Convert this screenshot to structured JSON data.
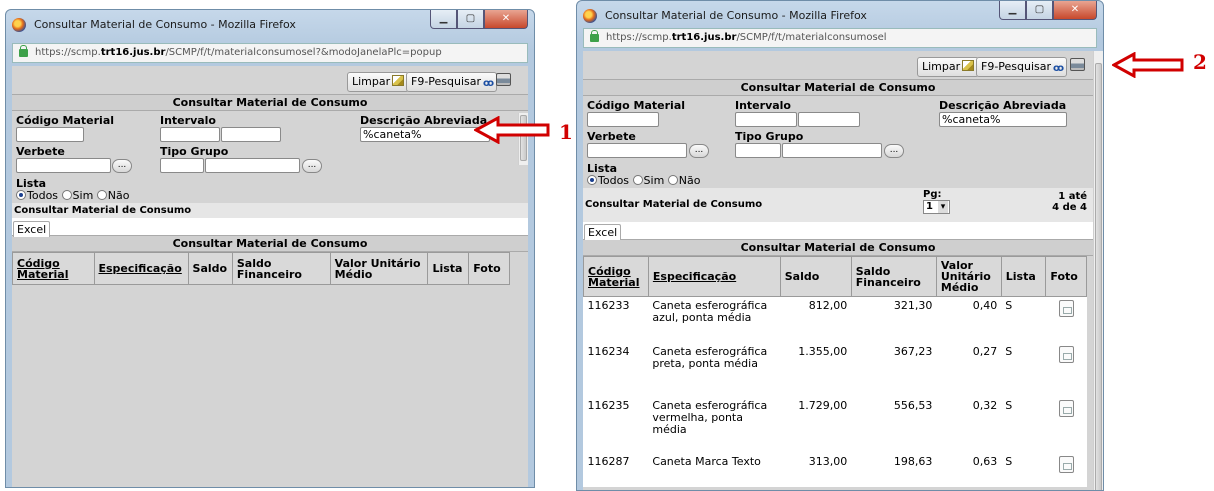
{
  "left_window": {
    "title": "Consultar Material de Consumo - Mozilla Firefox",
    "url_prefix": "https://scmp.",
    "url_domain": "trt16.jus.br",
    "url_path": "/SCMP/f/t/materialconsumosel?&modoJanelaPlc=popup",
    "toolbar": {
      "limpar": "Limpar",
      "pesquisar": "F9-Pesquisar"
    },
    "section_title": "Consultar Material de Consumo",
    "form": {
      "codigo_label": "Código Material",
      "intervalo_label": "Intervalo",
      "descricao_label": "Descrição Abreviada",
      "descricao_value": "%caneta%",
      "verbete_label": "Verbete",
      "tipo_grupo_label": "Tipo Grupo",
      "lista_label": "Lista",
      "dots_label": "...",
      "radio_todos": "Todos",
      "radio_sim": "Sim",
      "radio_nao": "Não"
    },
    "results_header": "Consultar Material de Consumo",
    "excel": "Excel",
    "grid_title": "Consultar Material de Consumo",
    "columns": [
      "Código Material",
      "Especificação",
      "Saldo",
      "Saldo Financeiro",
      "Valor Unitário Médio",
      "Lista",
      "Foto"
    ]
  },
  "right_window": {
    "title": "Consultar Material de Consumo - Mozilla Firefox",
    "url_prefix": "https://scmp.",
    "url_domain": "trt16.jus.br",
    "url_path": "/SCMP/f/t/materialconsumosel",
    "toolbar": {
      "limpar": "Limpar",
      "pesquisar": "F9-Pesquisar"
    },
    "section_title": "Consultar Material de Consumo",
    "form": {
      "codigo_label": "Código Material",
      "intervalo_label": "Intervalo",
      "descricao_label": "Descrição Abreviada",
      "descricao_value": "%caneta%",
      "verbete_label": "Verbete",
      "tipo_grupo_label": "Tipo Grupo",
      "lista_label": "Lista",
      "dots_label": "...",
      "radio_todos": "Todos",
      "radio_sim": "Sim",
      "radio_nao": "Não"
    },
    "results_header": "Consultar Material de Consumo",
    "pg_label": "Pg:",
    "pg_value": "1",
    "range_line1": "1 até",
    "range_line2": "4 de 4",
    "excel": "Excel",
    "grid_title": "Consultar Material de Consumo",
    "columns": [
      "Código Material",
      "Especificação",
      "Saldo",
      "Saldo Financeiro",
      "Valor Unitário Médio",
      "Lista",
      "Foto"
    ],
    "rows": [
      {
        "codigo": "116233",
        "especificacao": "Caneta esferográfica azul, ponta média",
        "saldo": "812,00",
        "saldo_fin": "321,30",
        "valor": "0,40",
        "lista": "S"
      },
      {
        "codigo": "116234",
        "especificacao": "Caneta esferográfica preta, ponta média",
        "saldo": "1.355,00",
        "saldo_fin": "367,23",
        "valor": "0,27",
        "lista": "S"
      },
      {
        "codigo": "116235",
        "especificacao": "Caneta esferográfica vermelha, ponta média",
        "saldo": "1.729,00",
        "saldo_fin": "556,53",
        "valor": "0,32",
        "lista": "S"
      },
      {
        "codigo": "116287",
        "especificacao": "Caneta Marca Texto",
        "saldo": "313,00",
        "saldo_fin": "198,63",
        "valor": "0,63",
        "lista": "S"
      }
    ]
  },
  "annotations": {
    "callout_1": "1",
    "callout_2": "2",
    "arrow_color": "#d10000"
  }
}
